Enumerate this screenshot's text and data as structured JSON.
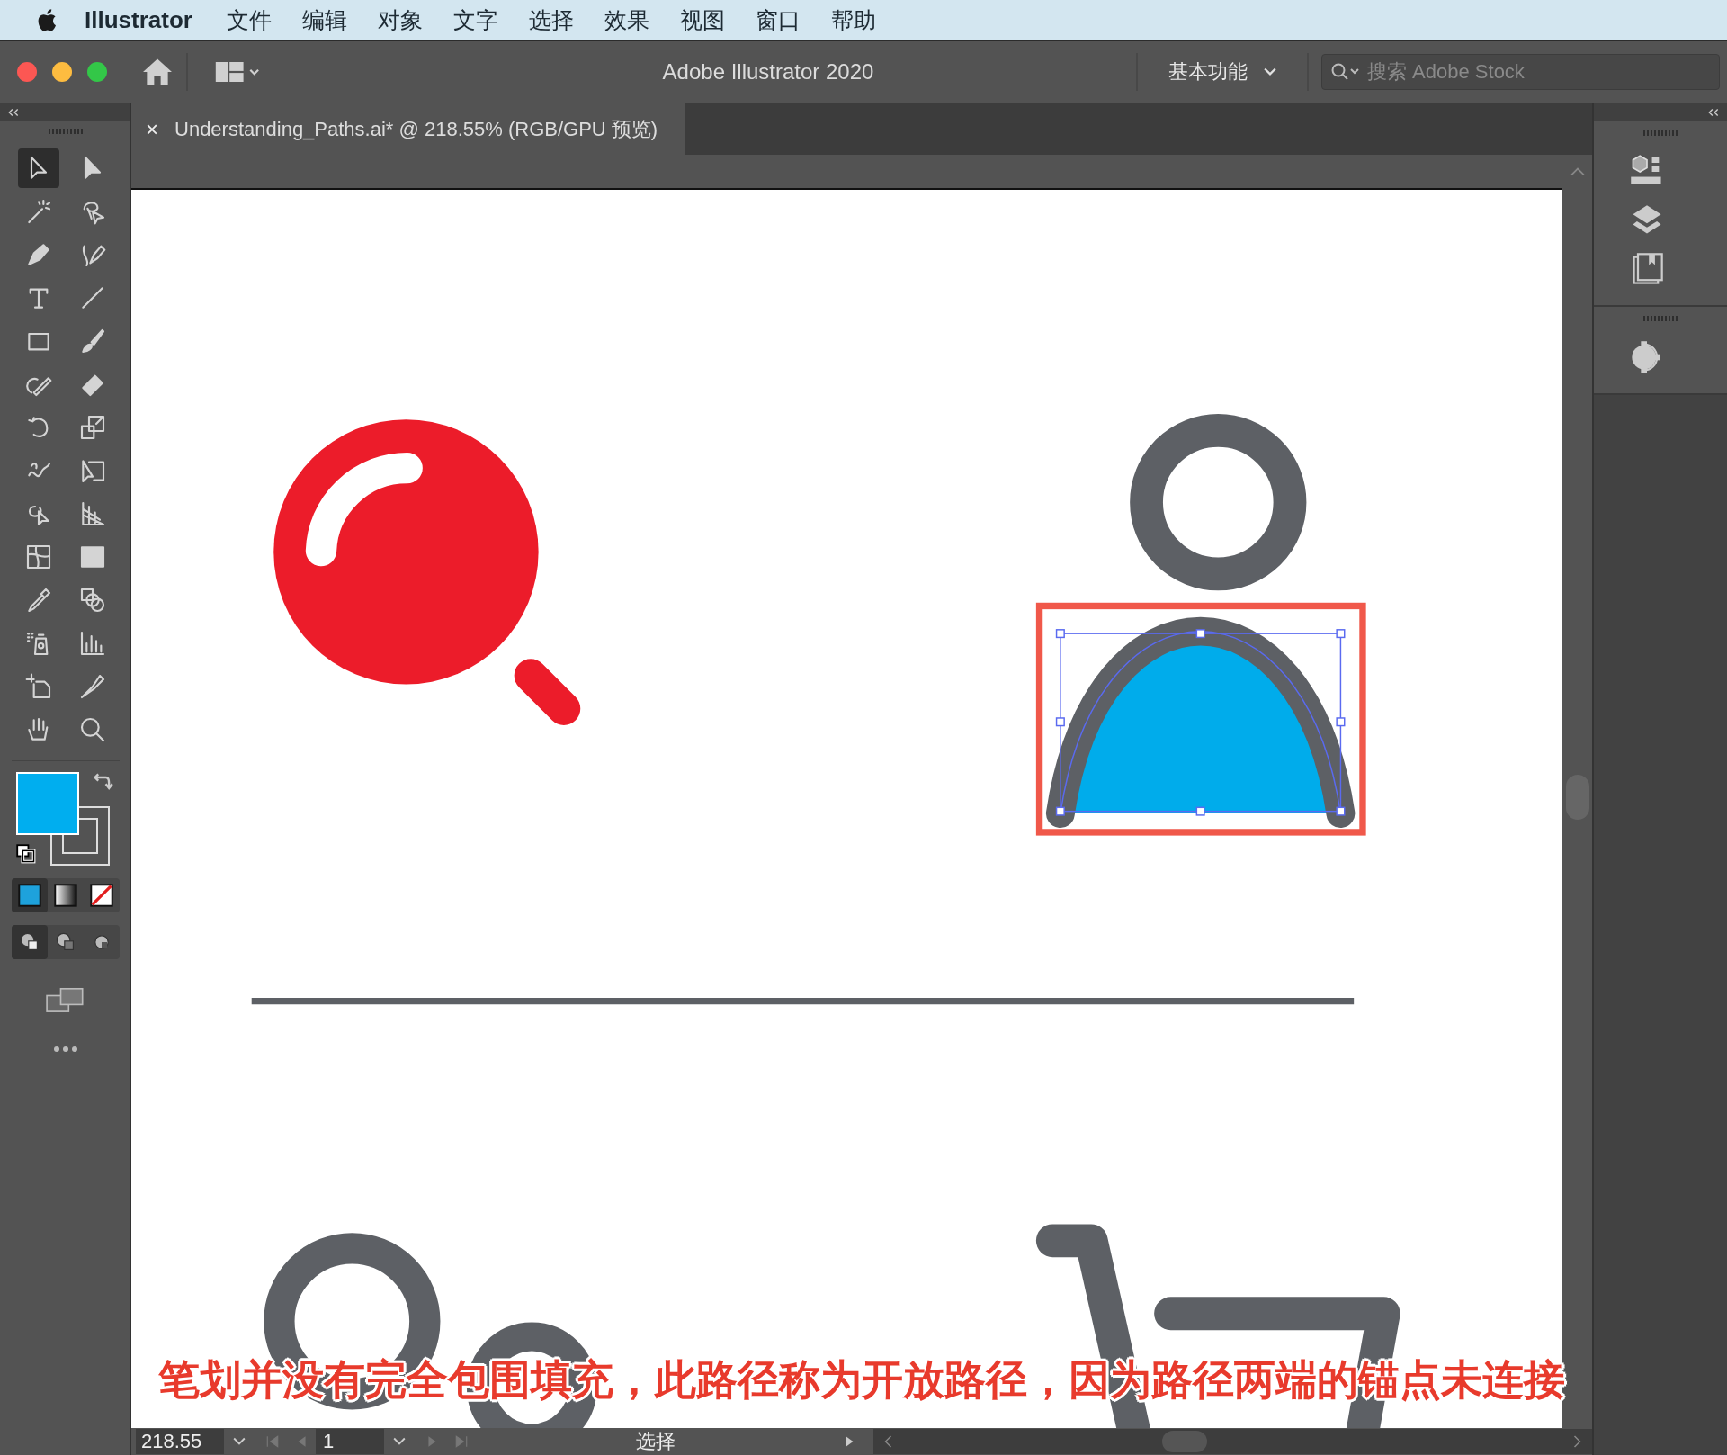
{
  "menu_bar": {
    "app_name": "Illustrator",
    "items": [
      "文件",
      "编辑",
      "对象",
      "文字",
      "选择",
      "效果",
      "视图",
      "窗口",
      "帮助"
    ]
  },
  "title_bar": {
    "title": "Adobe Illustrator 2020",
    "workspace": "基本功能",
    "search": {
      "placeholder": "搜索 Adobe Stock"
    }
  },
  "document_tab": {
    "close": "×",
    "title": "Understanding_Paths.ai* @ 218.55% (RGB/GPU 预览)",
    "selected": true
  },
  "tools": [
    {
      "selected": true
    },
    {
      "selected": false
    },
    {
      "selected": false
    },
    {
      "selected": false
    },
    {
      "selected": false
    },
    {
      "selected": false
    },
    {
      "selected": false
    },
    {
      "selected": false
    },
    {
      "selected": false
    },
    {
      "selected": false
    },
    {
      "selected": false
    },
    {
      "selected": false
    },
    {
      "selected": false
    },
    {
      "selected": false
    },
    {
      "selected": false
    },
    {
      "selected": false
    },
    {
      "selected": false
    },
    {
      "selected": false
    },
    {
      "selected": false
    },
    {
      "selected": false
    },
    {
      "selected": false
    },
    {
      "selected": false
    },
    {
      "selected": false
    },
    {
      "selected": false
    },
    {
      "selected": false
    },
    {
      "selected": false
    },
    {
      "selected": false
    },
    {
      "selected": false
    }
  ],
  "color_modes": [
    {
      "kind": "color",
      "selected": true
    },
    {
      "kind": "gradient",
      "selected": false
    },
    {
      "kind": "none",
      "selected": false
    }
  ],
  "draw_modes": [
    {
      "kind": "normal",
      "selected": true
    },
    {
      "kind": "behind",
      "selected": false
    },
    {
      "kind": "inside",
      "selected": false
    }
  ],
  "caption": "笔划并没有完全包围填充，此路径称为开放路径，因为路径两端的锚点未连接",
  "status_bar": {
    "zoom": "218.55",
    "page": "1",
    "tool": "选择"
  }
}
